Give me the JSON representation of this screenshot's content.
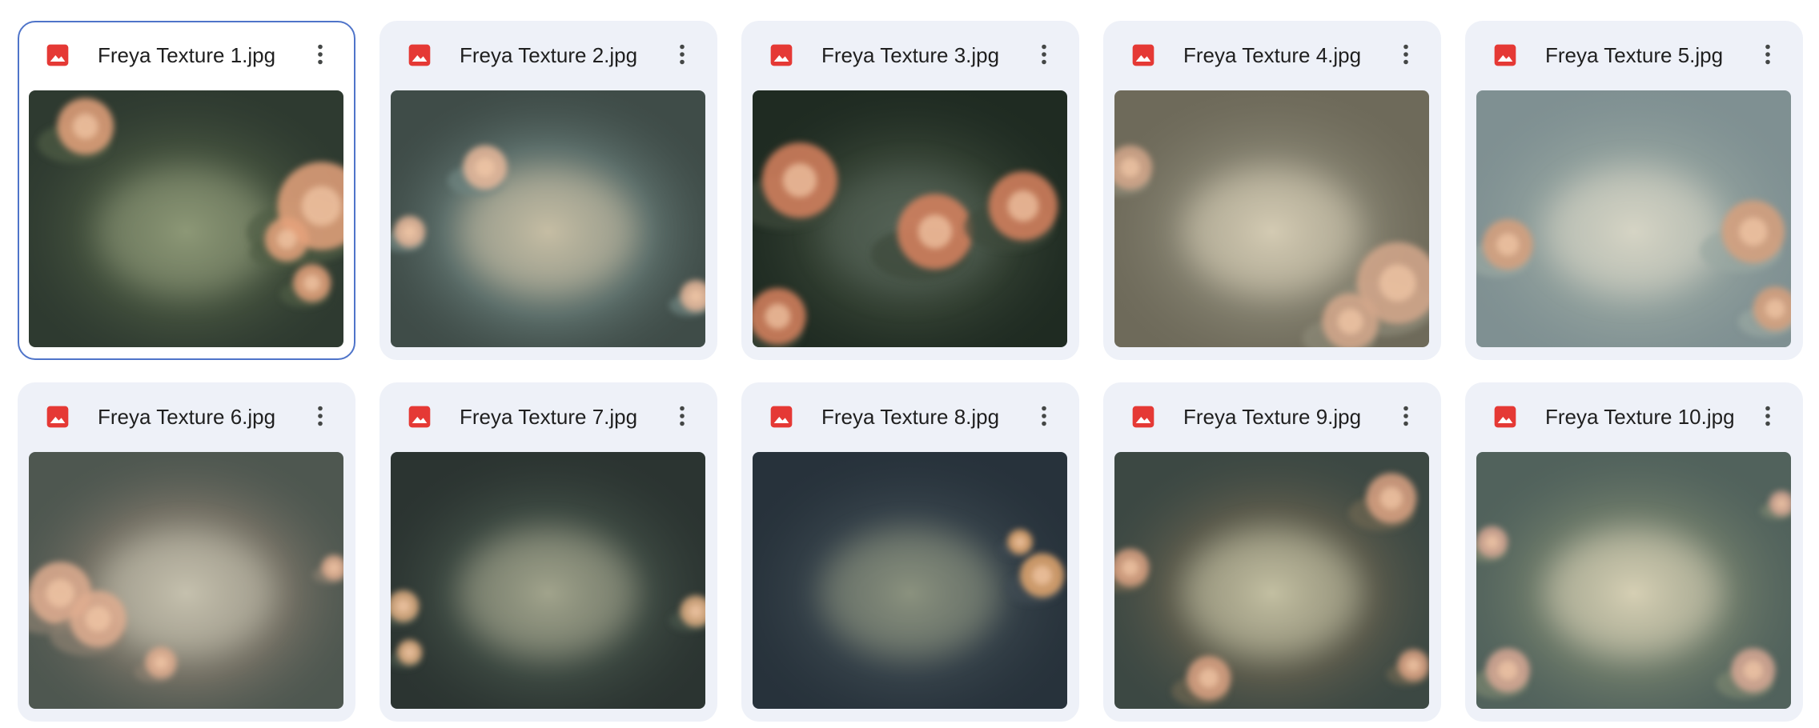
{
  "files": [
    {
      "name": "Freya Texture 1.jpg",
      "selected": true,
      "palette": {
        "base": "#2e3a30",
        "haze": "#8f9a78",
        "flower": "#e5a27c",
        "accent": "#4f5d45"
      },
      "flowers": [
        [
          0.18,
          0.14,
          0.09
        ],
        [
          0.93,
          0.45,
          0.14
        ],
        [
          0.82,
          0.58,
          0.07
        ],
        [
          0.9,
          0.75,
          0.06
        ]
      ]
    },
    {
      "name": "Freya Texture 2.jpg",
      "selected": false,
      "palette": {
        "base": "#3f4c48",
        "haze": "#c9c0a6",
        "flower": "#e9b99b",
        "accent": "#6f8581"
      },
      "flowers": [
        [
          0.3,
          0.3,
          0.07
        ],
        [
          0.06,
          0.55,
          0.05
        ],
        [
          0.97,
          0.8,
          0.05
        ]
      ]
    },
    {
      "name": "Freya Texture 3.jpg",
      "selected": false,
      "palette": {
        "base": "#1f2b22",
        "haze": "#58665a",
        "flower": "#d9825f",
        "accent": "#3d4a3a"
      },
      "flowers": [
        [
          0.15,
          0.35,
          0.12
        ],
        [
          0.58,
          0.55,
          0.12
        ],
        [
          0.86,
          0.45,
          0.11
        ],
        [
          0.08,
          0.88,
          0.09
        ]
      ]
    },
    {
      "name": "Freya Texture 4.jpg",
      "selected": false,
      "palette": {
        "base": "#6e6a5a",
        "haze": "#d6cdb5",
        "flower": "#d4a78b",
        "accent": "#8d8a78"
      },
      "flowers": [
        [
          0.05,
          0.3,
          0.07
        ],
        [
          0.9,
          0.75,
          0.13
        ],
        [
          0.75,
          0.9,
          0.09
        ]
      ]
    },
    {
      "name": "Freya Texture 5.jpg",
      "selected": false,
      "palette": {
        "base": "#7f9092",
        "haze": "#d8d6c6",
        "flower": "#d8a07d",
        "accent": "#9aa8a2"
      },
      "flowers": [
        [
          0.1,
          0.6,
          0.08
        ],
        [
          0.88,
          0.55,
          0.1
        ],
        [
          0.95,
          0.85,
          0.07
        ]
      ]
    },
    {
      "name": "Freya Texture 6.jpg",
      "selected": false,
      "palette": {
        "base": "#4e5750",
        "haze": "#c8c3b0",
        "flower": "#e0ad90",
        "accent": "#8a7f70"
      },
      "flowers": [
        [
          0.1,
          0.55,
          0.1
        ],
        [
          0.22,
          0.65,
          0.09
        ],
        [
          0.42,
          0.82,
          0.05
        ],
        [
          0.97,
          0.45,
          0.04
        ]
      ]
    },
    {
      "name": "Freya Texture 7.jpg",
      "selected": false,
      "palette": {
        "base": "#2b3431",
        "haze": "#a4a68e",
        "flower": "#e2b083",
        "accent": "#48564c"
      },
      "flowers": [
        [
          0.04,
          0.6,
          0.05
        ],
        [
          0.06,
          0.78,
          0.04
        ],
        [
          0.97,
          0.62,
          0.05
        ]
      ]
    },
    {
      "name": "Freya Texture 8.jpg",
      "selected": false,
      "palette": {
        "base": "#27323b",
        "haze": "#8d9480",
        "flower": "#e4a86f",
        "accent": "#3f4b52"
      },
      "flowers": [
        [
          0.92,
          0.48,
          0.07
        ],
        [
          0.85,
          0.35,
          0.04
        ]
      ]
    },
    {
      "name": "Freya Texture 9.jpg",
      "selected": false,
      "palette": {
        "base": "#3c4843",
        "haze": "#c6c2a4",
        "flower": "#dca383",
        "accent": "#6e6651"
      },
      "flowers": [
        [
          0.05,
          0.45,
          0.06
        ],
        [
          0.88,
          0.18,
          0.08
        ],
        [
          0.3,
          0.88,
          0.07
        ],
        [
          0.95,
          0.83,
          0.05
        ]
      ]
    },
    {
      "name": "Freya Texture 10.jpg",
      "selected": false,
      "palette": {
        "base": "#51625c",
        "haze": "#d9d2b6",
        "flower": "#d9a995",
        "accent": "#7b8670"
      },
      "flowers": [
        [
          0.05,
          0.35,
          0.05
        ],
        [
          0.1,
          0.85,
          0.07
        ],
        [
          0.88,
          0.85,
          0.07
        ],
        [
          0.97,
          0.2,
          0.04
        ]
      ]
    }
  ],
  "icons": {
    "file_type": "image-icon",
    "menu": "more-vert-icon"
  },
  "colors": {
    "image_icon": "#e53935",
    "selected_border": "#4f74c9",
    "card_bg": "#eef1f8"
  }
}
